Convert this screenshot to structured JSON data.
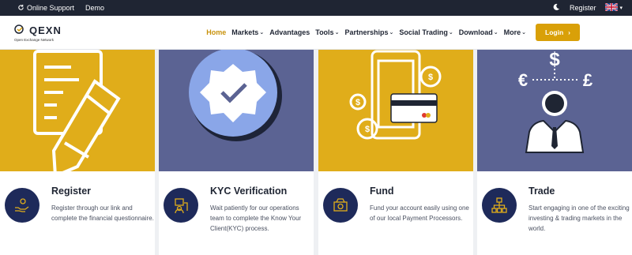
{
  "topbar": {
    "support_label": "Online Support",
    "demo_label": "Demo",
    "register_label": "Register"
  },
  "logo": {
    "name": "QEXN",
    "tagline": "Open Exchange Network"
  },
  "nav": {
    "items": [
      {
        "label": "Home",
        "active": true
      },
      {
        "label": "Markets"
      },
      {
        "label": "Advantages"
      },
      {
        "label": "Tools"
      },
      {
        "label": "Partnerships"
      },
      {
        "label": "Social Trading"
      },
      {
        "label": "Download"
      },
      {
        "label": "More"
      }
    ],
    "login_label": "Login"
  },
  "cards": [
    {
      "title": "Register",
      "text": "Register through our link and complete the financial questionnaire.",
      "bg": "#e0ad1a",
      "icon": "register-hand-icon"
    },
    {
      "title": "KYC Verification",
      "text": "Wait patiently for our operations team to complete the Know Your Client(KYC) process.",
      "bg": "#5b6393",
      "icon": "kyc-id-icon"
    },
    {
      "title": "Fund",
      "text": "Fund your account easily using one of our local Payment Processors.",
      "bg": "#e0ad1a",
      "icon": "fund-money-icon"
    },
    {
      "title": "Trade",
      "text": "Start engaging in one of the exciting investing & trading markets in the world.",
      "bg": "#5b6393",
      "icon": "trade-network-icon"
    }
  ],
  "colors": {
    "accent": "#d9a008",
    "dark": "#1f2533",
    "navy": "#1e2a5a"
  }
}
